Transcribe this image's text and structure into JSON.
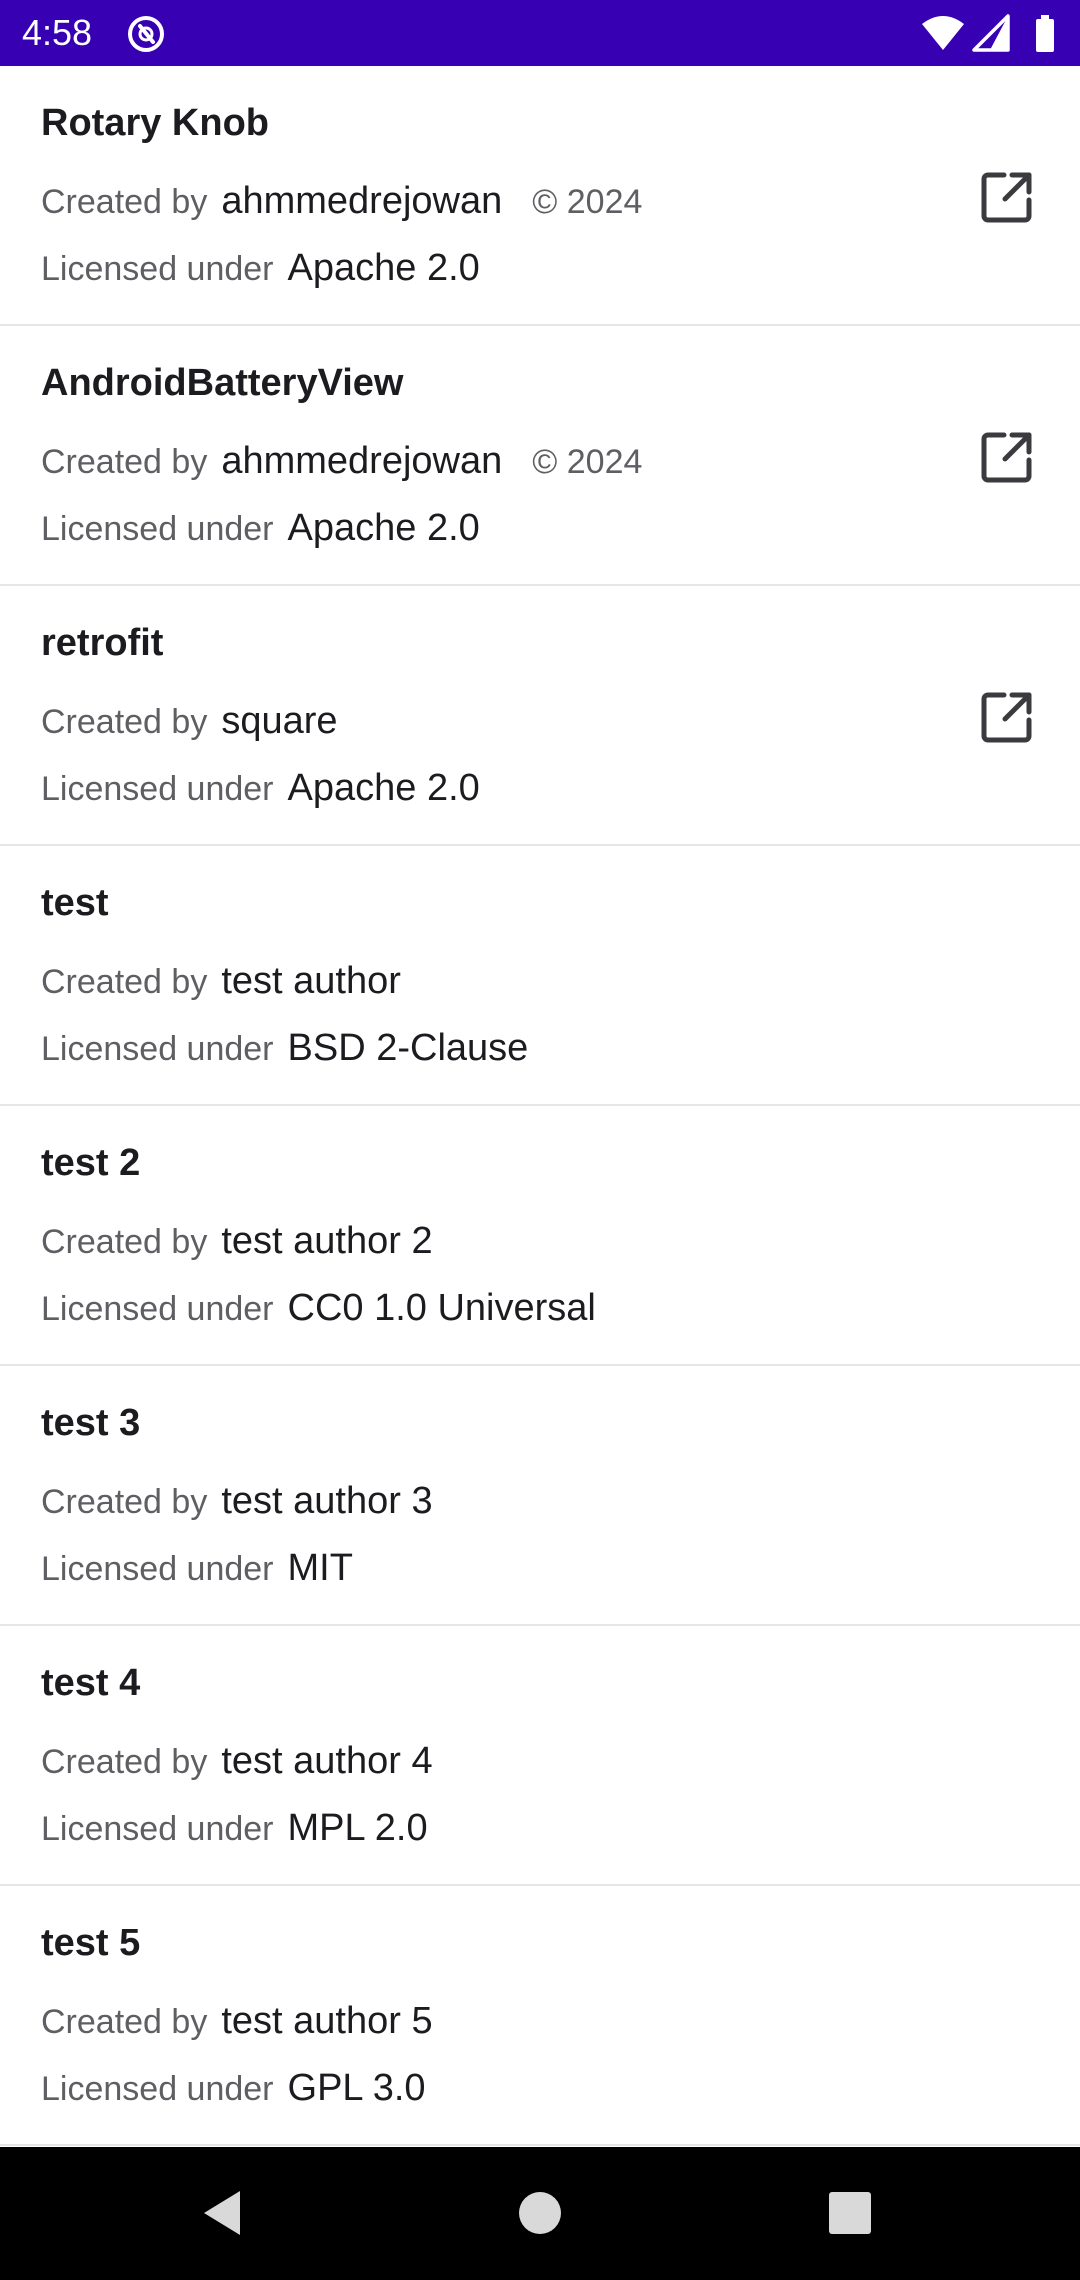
{
  "status_bar": {
    "time": "4:58",
    "background": "#3700b3",
    "icons": [
      "app-notification-icon",
      "wifi-icon",
      "signal-icon",
      "battery-icon"
    ]
  },
  "labels": {
    "created_by": "Created by",
    "licensed_under": "Licensed under"
  },
  "libraries": [
    {
      "title": "Rotary Knob",
      "author": "ahmmedrejowan",
      "year": "© 2024",
      "license": "Apache 2.0",
      "has_link": true
    },
    {
      "title": "AndroidBatteryView",
      "author": "ahmmedrejowan",
      "year": "© 2024",
      "license": "Apache 2.0",
      "has_link": true
    },
    {
      "title": "retrofit",
      "author": "square",
      "year": "",
      "license": "Apache 2.0",
      "has_link": true
    },
    {
      "title": "test",
      "author": "test author",
      "year": "",
      "license": "BSD 2-Clause",
      "has_link": false
    },
    {
      "title": "test 2",
      "author": "test author 2",
      "year": "",
      "license": "CC0 1.0 Universal",
      "has_link": false
    },
    {
      "title": "test 3",
      "author": "test author 3",
      "year": "",
      "license": "MIT",
      "has_link": false
    },
    {
      "title": "test 4",
      "author": "test author 4",
      "year": "",
      "license": "MPL 2.0",
      "has_link": false
    },
    {
      "title": "test 5",
      "author": "test author 5",
      "year": "",
      "license": "GPL 3.0",
      "has_link": false
    }
  ],
  "nav_bar": {
    "buttons": [
      "back-icon",
      "home-icon",
      "recents-icon"
    ]
  }
}
